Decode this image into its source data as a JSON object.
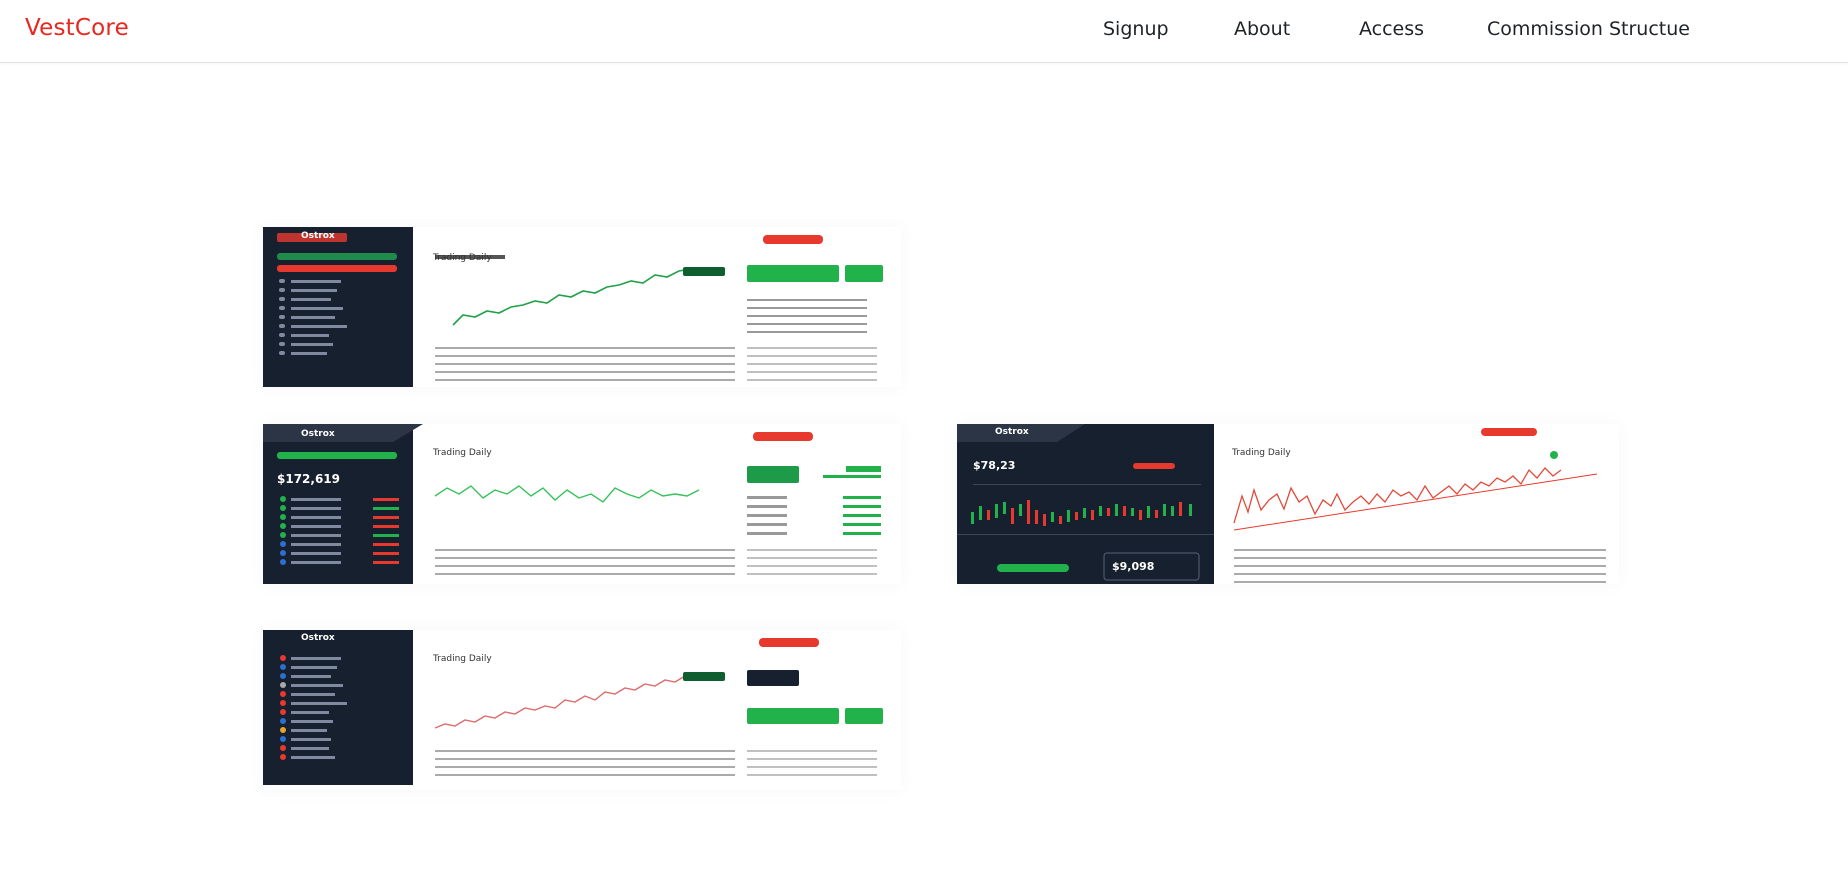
{
  "brand": {
    "name": "VestCore",
    "color": "#e8271f"
  },
  "nav": {
    "links": [
      {
        "label": "Signup"
      },
      {
        "label": "About"
      },
      {
        "label": "Access"
      },
      {
        "label": "Commission Structue"
      }
    ]
  },
  "screenshots": [
    {
      "app_name": "Ostrox",
      "chart_title": "Trading Daily",
      "theme": "dark-sidebar",
      "series_color": "#22a04a"
    },
    {
      "app_name": "Ostrox",
      "chart_title": "Trading Daily",
      "balance": "$172,619",
      "theme": "dark-sidebar",
      "series_color": "#38c25c"
    },
    {
      "app_name": "Ostrox",
      "chart_title": "Trading Daily",
      "price": "$78,23",
      "total": "$9,098",
      "theme": "dark-panel",
      "series_color": "#e24a3a"
    },
    {
      "app_name": "Ostrox",
      "chart_title": "Trading Daily",
      "theme": "dark-sidebar",
      "series_color": "#e06a6a"
    }
  ],
  "colors": {
    "sidebar": "#17202e",
    "red": "#e8392e",
    "green": "#22b24c",
    "nav_text": "#1f2328"
  }
}
